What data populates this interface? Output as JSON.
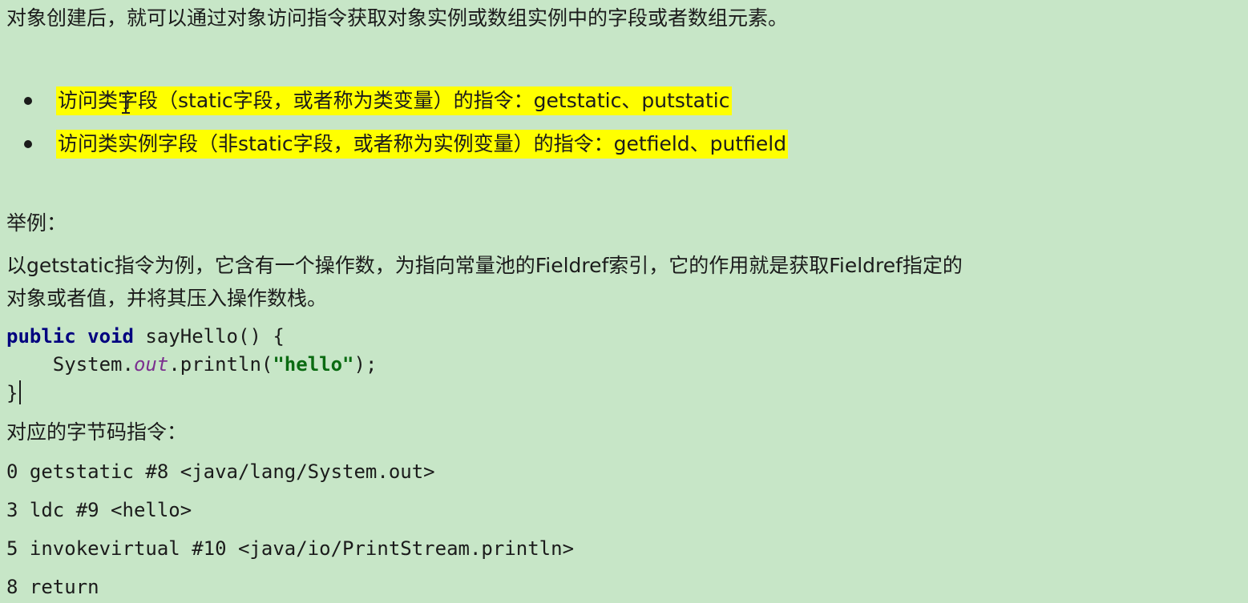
{
  "intro": "对象创建后，就可以通过对象访问指令获取对象实例或数组实例中的字段或者数组元素。",
  "bullets": [
    "访问类字段（static字段，或者称为类变量）的指令：getstatic、putstatic",
    "访问类实例字段（非static字段，或者称为实例变量）的指令：getfield、putfield"
  ],
  "example_label": "举例：",
  "description_line1": "以getstatic指令为例，它含有一个操作数，为指向常量池的Fieldref索引，它的作用就是获取Fieldref指定的",
  "description_line2": "对象或者值，并将其压入操作数栈。",
  "code": {
    "kw_public": "public",
    "kw_void": "void",
    "method_decl": " sayHello() {",
    "indent": "    ",
    "system": "System.",
    "out": "out",
    "println_open": ".println(",
    "string_literal": "\"hello\"",
    "close_stmt": ");",
    "closing_brace": "}"
  },
  "bytecode_label": "对应的字节码指令：",
  "bytecode": [
    "0 getstatic #8 <java/lang/System.out>",
    "3 ldc #9 <hello>",
    "5 invokevirtual #10 <java/io/PrintStream.println>",
    "8 return"
  ]
}
